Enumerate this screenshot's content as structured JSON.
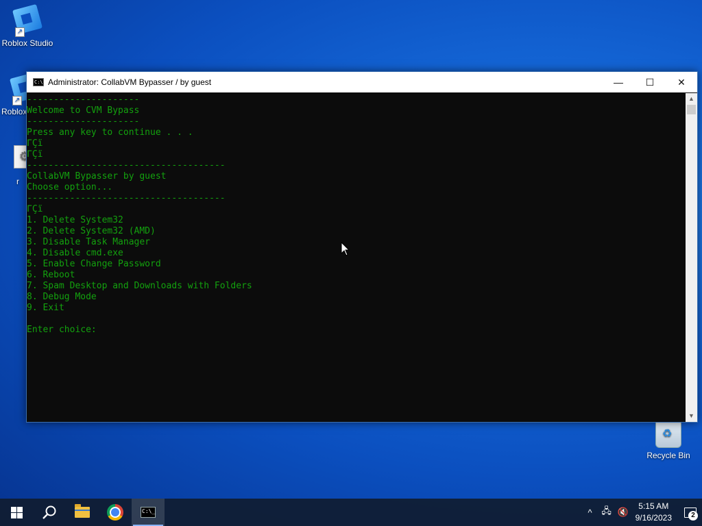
{
  "desktop": {
    "icons": [
      {
        "label": "Roblox Studio"
      },
      {
        "label": "Roblox"
      },
      {
        "label": "r"
      },
      {
        "label": "Recycle Bin"
      }
    ]
  },
  "window": {
    "title": "Administrator:  CollabVM Bypasser / by guest",
    "controls": {
      "minimize": "—",
      "maximize": "☐",
      "close": "✕"
    },
    "console_lines": [
      "---------------------",
      "Welcome to CVM Bypass",
      "---------------------",
      "Press any key to continue . . .",
      "ΓÇï",
      "ΓÇï",
      "-------------------------------------",
      "CollabVM Bypasser by guest",
      "Choose option...",
      "-------------------------------------",
      "ΓÇï",
      "1. Delete System32",
      "2. Delete System32 (AMD)",
      "3. Disable Task Manager",
      "4. Disable cmd.exe",
      "5. Enable Change Password",
      "6. Reboot",
      "7. Spam Desktop and Downloads with Folders",
      "8. Debug Mode",
      "9. Exit",
      "",
      "Enter choice: "
    ],
    "text_color": "#13a10e"
  },
  "taskbar": {
    "cmd_icon_text": "C:\\_",
    "tray": {
      "chevron": "^",
      "network": "🖧",
      "volume": "🔇",
      "time": "5:15 AM",
      "date": "9/16/2023",
      "notification_count": "2"
    }
  }
}
